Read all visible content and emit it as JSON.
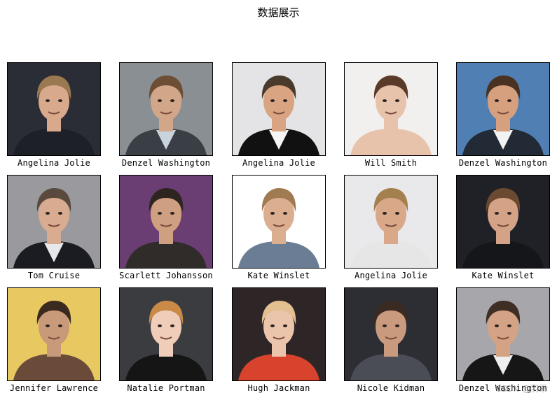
{
  "title": "数据展示",
  "watermark": "CSDN @羽秉",
  "chart_data": {
    "type": "image_grid",
    "rows": 3,
    "cols": 5,
    "labels": [
      "Angelina Jolie",
      "Denzel Washington",
      "Angelina Jolie",
      "Will Smith",
      "Denzel Washington",
      "Tom Cruise",
      "Scarlett Johansson",
      "Kate Winslet",
      "Angelina Jolie",
      "Kate Winslet",
      "Jennifer Lawrence",
      "Natalie Portman",
      "Hugh Jackman",
      "Nicole Kidman",
      "Denzel Washington"
    ]
  },
  "photos": [
    {
      "bg": "#2a2c36",
      "skin": "#d9a98c",
      "hair": "#9a7850",
      "suit": "#1e2028",
      "shirt": "#1e2028"
    },
    {
      "bg": "#8a8f94",
      "skin": "#d2a688",
      "hair": "#6b4e34",
      "suit": "#3a3f45",
      "shirt": "#c9d3dc"
    },
    {
      "bg": "#e4e4e6",
      "skin": "#d9a482",
      "hair": "#4a3a2c",
      "suit": "#111111",
      "shirt": "#f4f4f4"
    },
    {
      "bg": "#f2f0ef",
      "skin": "#e8c3ab",
      "hair": "#5a3a28",
      "suit": "#e8c3ab",
      "shirt": "#e8c3ab"
    },
    {
      "bg": "#4f7fb3",
      "skin": "#d6a07e",
      "hair": "#4a3222",
      "suit": "#222a36",
      "shirt": "#f2f2f2"
    },
    {
      "bg": "#9a9a9e",
      "skin": "#d9ab90",
      "hair": "#5a4a3e",
      "suit": "#1a1c22",
      "shirt": "#e6e8ec"
    },
    {
      "bg": "#6a3e72",
      "skin": "#cf9f82",
      "hair": "#2e2420",
      "suit": "#2f2c2a",
      "shirt": "#2f2c2a"
    },
    {
      "bg": "#ffffff",
      "skin": "#dcae90",
      "hair": "#a07a50",
      "suit": "#6b7d94",
      "shirt": "#6b7d94"
    },
    {
      "bg": "#e9e8ea",
      "skin": "#d8a888",
      "hair": "#a4804e",
      "suit": "#e6e6e6",
      "shirt": "#e6e6e6"
    },
    {
      "bg": "#1f2126",
      "skin": "#d4a286",
      "hair": "#6a4a30",
      "suit": "#141619",
      "shirt": "#141619"
    },
    {
      "bg": "#e8c860",
      "skin": "#c99a7a",
      "hair": "#3a2a20",
      "suit": "#6a4b3a",
      "shirt": "#6a4b3a"
    },
    {
      "bg": "#3a3c40",
      "skin": "#f0cdb8",
      "hair": "#c98a48",
      "suit": "#151515",
      "shirt": "#151515"
    },
    {
      "bg": "#2e2626",
      "skin": "#eac5ac",
      "hair": "#e2c090",
      "suit": "#d8432e",
      "shirt": "#d8432e"
    },
    {
      "bg": "#2c2e33",
      "skin": "#c99a7e",
      "hair": "#3a2a22",
      "suit": "#4a4d55",
      "shirt": "#4a4d55"
    },
    {
      "bg": "#a7a7ab",
      "skin": "#d4a284",
      "hair": "#3e2e24",
      "suit": "#161616",
      "shirt": "#eeeeee"
    }
  ]
}
